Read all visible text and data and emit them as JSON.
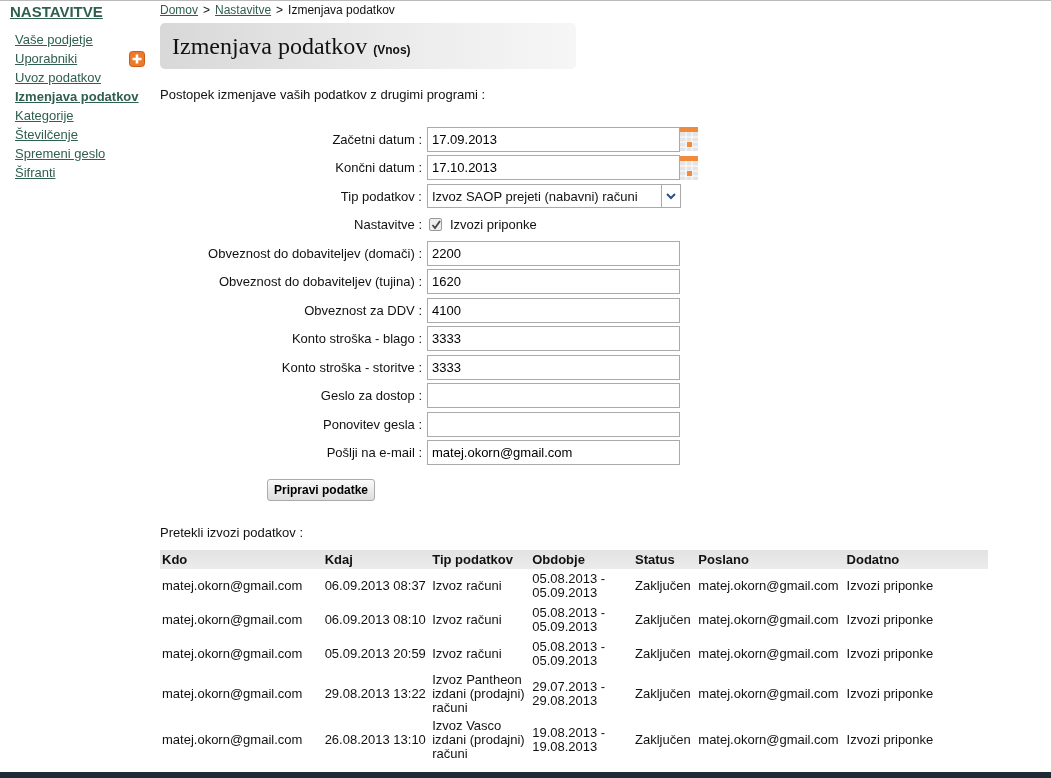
{
  "sidebar": {
    "title": "NASTAVITVE",
    "items": [
      {
        "label": "Vaše podjetje",
        "selected": false,
        "add": false
      },
      {
        "label": "Uporabniki",
        "selected": false,
        "add": true
      },
      {
        "label": "Uvoz podatkov",
        "selected": false,
        "add": false
      },
      {
        "label": "Izmenjava podatkov",
        "selected": true,
        "add": false
      },
      {
        "label": "Kategorije",
        "selected": false,
        "add": false
      },
      {
        "label": "Številčenje",
        "selected": false,
        "add": false
      },
      {
        "label": "Spremeni geslo",
        "selected": false,
        "add": false
      },
      {
        "label": "Šifranti",
        "selected": false,
        "add": false
      }
    ]
  },
  "breadcrumb": {
    "links": [
      "Domov",
      "Nastavitve"
    ],
    "separator": ">",
    "current": "Izmenjava podatkov"
  },
  "header": {
    "title": "Izmenjava podatkov",
    "subtitle": "(Vnos)"
  },
  "intro": "Postopek izmenjave vaših podatkov z drugimi programi :",
  "form": {
    "fields": [
      {
        "kind": "date",
        "label": "Začetni datum :",
        "value": "17.09.2013"
      },
      {
        "kind": "date",
        "label": "Končni datum :",
        "value": "17.10.2013"
      },
      {
        "kind": "select",
        "label": "Tip podatkov :",
        "value": "Izvoz SAOP prejeti (nabavni) računi"
      },
      {
        "kind": "checkbox",
        "label": "Nastavitve :",
        "option": "Izvozi priponke",
        "checked": true
      },
      {
        "kind": "text",
        "label": "Obveznost do dobaviteljev (domači) :",
        "value": "2200"
      },
      {
        "kind": "text",
        "label": "Obveznost do dobaviteljev (tujina) :",
        "value": "1620"
      },
      {
        "kind": "text",
        "label": "Obveznost za DDV :",
        "value": "4100"
      },
      {
        "kind": "text",
        "label": "Konto stroška - blago :",
        "value": "3333"
      },
      {
        "kind": "text",
        "label": "Konto stroška - storitve :",
        "value": "3333"
      },
      {
        "kind": "text",
        "label": "Geslo za dostop :"
      },
      {
        "kind": "text",
        "label": "Ponovitev gesla :"
      },
      {
        "kind": "text",
        "label": "Pošlji na e-mail :",
        "value": "matej.okorn@gmail.com"
      }
    ],
    "submit": "Pripravi podatke"
  },
  "history": {
    "title": "Pretekli izvozi podatkov :",
    "columns": [
      "Kdo",
      "Kdaj",
      "Tip podatkov",
      "Obdobje",
      "Status",
      "Poslano",
      "Dodatno"
    ],
    "rows": [
      [
        "matej.okorn@gmail.com",
        "06.09.2013 08:37",
        "Izvoz računi",
        "05.08.2013 - 05.09.2013",
        "Zaključen",
        "matej.okorn@gmail.com",
        "Izvozi priponke"
      ],
      [
        "matej.okorn@gmail.com",
        "06.09.2013 08:10",
        "Izvoz računi",
        "05.08.2013 - 05.09.2013",
        "Zaključen",
        "matej.okorn@gmail.com",
        "Izvozi priponke"
      ],
      [
        "matej.okorn@gmail.com",
        "05.09.2013 20:59",
        "Izvoz računi",
        "05.08.2013 - 05.09.2013",
        "Zaključen",
        "matej.okorn@gmail.com",
        "Izvozi priponke"
      ],
      [
        "matej.okorn@gmail.com",
        "29.08.2013 13:22",
        "Izvoz Pantheon izdani (prodajni) računi",
        "29.07.2013 - 29.08.2013",
        "Zaključen",
        "matej.okorn@gmail.com",
        "Izvozi priponke"
      ],
      [
        "matej.okorn@gmail.com",
        "26.08.2013 13:10",
        "Izvoz Vasco izdani (prodajni) računi",
        "19.08.2013 - 19.08.2013",
        "Zaključen",
        "matej.okorn@gmail.com",
        "Izvozi priponke"
      ]
    ]
  }
}
